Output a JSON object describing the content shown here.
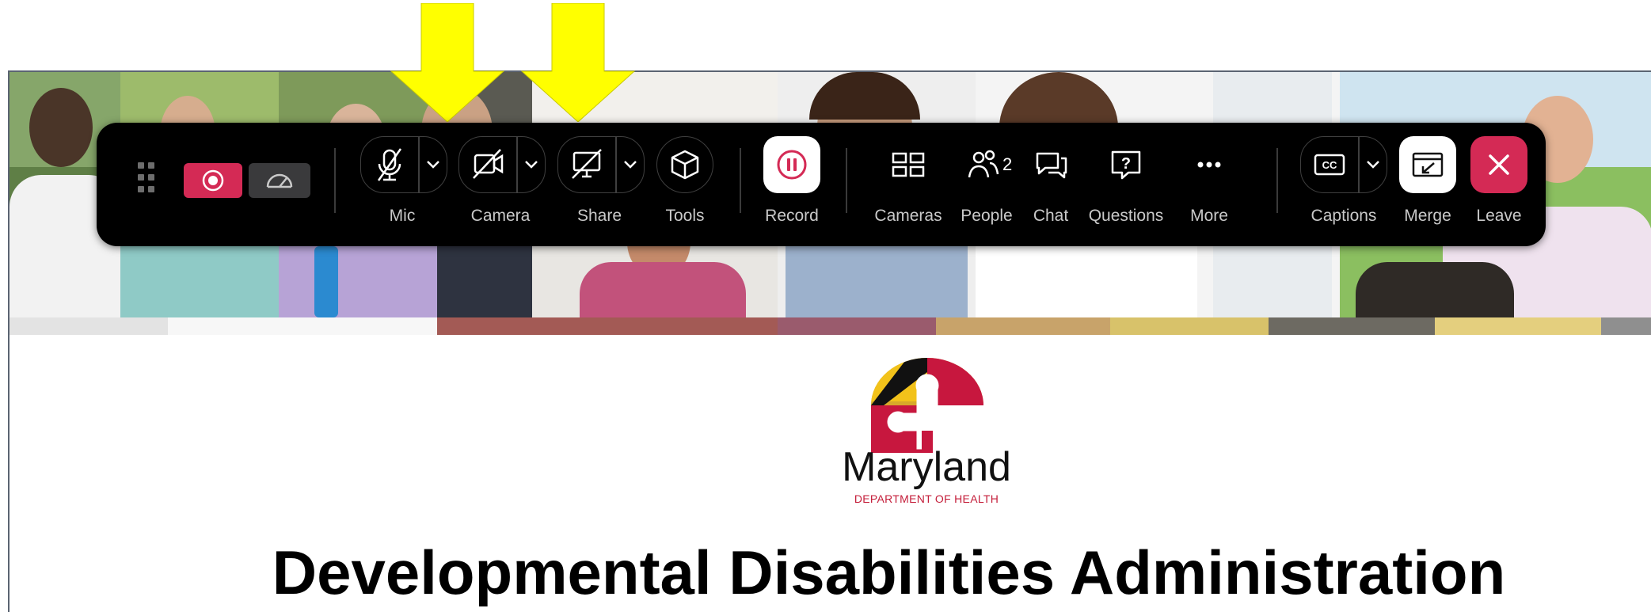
{
  "toolbar": {
    "drag_handle_icon": "grip-dots-icon",
    "recording_indicator_icon": "record-dot-icon",
    "network_quality_icon": "speedometer-icon",
    "mic": {
      "label": "Mic",
      "icon": "mic-muted-icon",
      "dropdown_icon": "chevron-down-icon"
    },
    "camera": {
      "label": "Camera",
      "icon": "camera-off-icon",
      "dropdown_icon": "chevron-down-icon"
    },
    "share": {
      "label": "Share",
      "icon": "share-screen-off-icon",
      "dropdown_icon": "chevron-down-icon"
    },
    "tools": {
      "label": "Tools",
      "icon": "cube-icon"
    },
    "record": {
      "label": "Record",
      "icon": "pause-circle-icon"
    },
    "cameras": {
      "label": "Cameras",
      "icon": "grid-layout-icon"
    },
    "people": {
      "label": "People",
      "icon": "people-icon",
      "count": "2"
    },
    "chat": {
      "label": "Chat",
      "icon": "chat-bubbles-icon"
    },
    "questions": {
      "label": "Questions",
      "icon": "question-bubble-icon"
    },
    "more": {
      "label": "More",
      "icon": "ellipsis-icon"
    },
    "captions": {
      "label": "Captions",
      "icon": "cc-icon",
      "dropdown_icon": "chevron-down-icon"
    },
    "merge": {
      "label": "Merge",
      "icon": "merge-window-icon"
    },
    "leave": {
      "label": "Leave",
      "icon": "close-icon"
    },
    "colors": {
      "record_red": "#d42a55",
      "leave_red": "#d42a55",
      "bg": "#000000"
    }
  },
  "annotations": {
    "arrow_color": "#ffff00"
  },
  "slide": {
    "logo_word": "Maryland",
    "logo_sub": "DEPARTMENT OF HEALTH",
    "title": "Developmental Disabilities Administration"
  }
}
